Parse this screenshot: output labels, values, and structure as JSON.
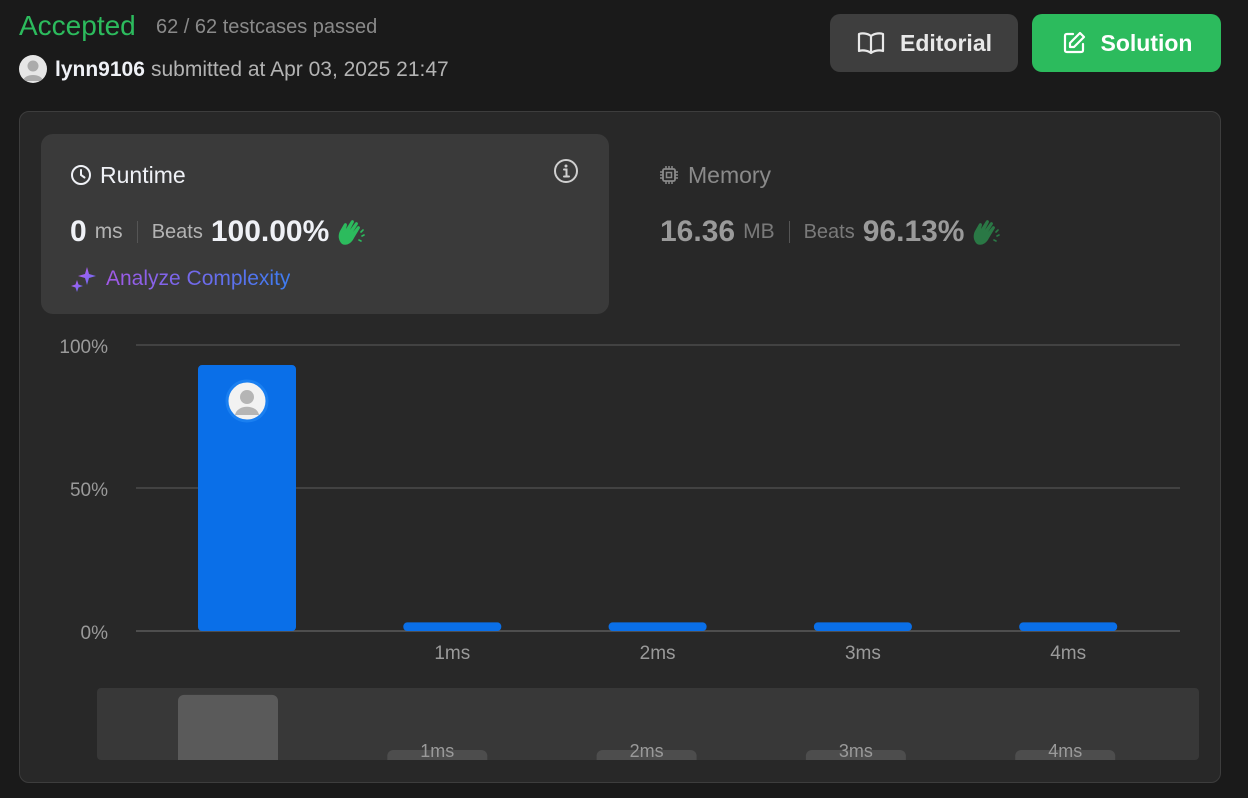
{
  "header": {
    "status": "Accepted",
    "testcases": "62 / 62 testcases passed",
    "username": "lynn9106",
    "submitted": "submitted at Apr 03, 2025 21:47",
    "editorial_label": "Editorial",
    "solution_label": "Solution"
  },
  "runtime": {
    "title": "Runtime",
    "value": "0",
    "unit": "ms",
    "beats_label": "Beats",
    "beats": "100.00%",
    "analyze_label": "Analyze Complexity"
  },
  "memory": {
    "title": "Memory",
    "value": "16.36",
    "unit": "MB",
    "beats_label": "Beats",
    "beats": "96.13%"
  },
  "colors": {
    "accepted": "#2cbb5d",
    "bar": "#0a6fe8",
    "solution_button": "#2cbb5d"
  },
  "chart_data": {
    "type": "bar",
    "categories": [
      "0ms",
      "1ms",
      "2ms",
      "3ms",
      "4ms"
    ],
    "tick_labels": [
      "",
      "1ms",
      "2ms",
      "3ms",
      "4ms"
    ],
    "values": [
      93,
      3,
      3,
      3,
      3
    ],
    "y_ticks": [
      "100%",
      "50%",
      "0%"
    ],
    "ylim": [
      0,
      100
    ],
    "highlight_index": 0,
    "grid": true,
    "minimap": {
      "tick_labels": [
        "",
        "1ms",
        "2ms",
        "3ms",
        "4ms"
      ],
      "values": [
        93,
        3,
        3,
        3,
        3
      ]
    }
  }
}
